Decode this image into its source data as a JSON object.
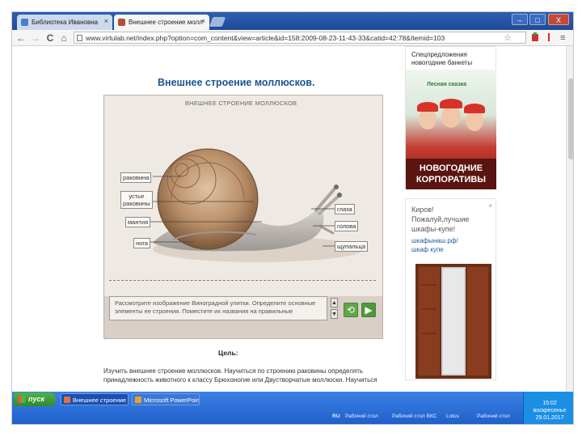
{
  "browser": {
    "tabs": [
      {
        "label": "Библиотека Ивановна",
        "close": "×"
      },
      {
        "label": "Внешнее строение молл",
        "close": "×"
      }
    ],
    "window_buttons": {
      "minimize": "–",
      "maximize": "□",
      "close": "X"
    },
    "nav": {
      "back": "←",
      "forward": "→",
      "reload": "C",
      "home": "⌂"
    },
    "url": "www.virtulab.net/index.php?option=com_content&view=article&id=158:2009-08-23-11-43-33&catid=42:78&Itemid=103",
    "star": "☆",
    "menu": "≡"
  },
  "page": {
    "title": "Внешнее строение моллюсков.",
    "widget": {
      "stage_title": "ВНЕШНЕЕ СТРОЕНИЕ МОЛЛЮСКОВ",
      "labels": {
        "shell": "раковина",
        "shell_mouth_1": "устье",
        "shell_mouth_2": "раковины",
        "mantle": "мантия",
        "foot": "нога",
        "eyes": "глаза",
        "head": "голова",
        "tentacles": "щупальца"
      },
      "instruction": "Рассмотрите изображение Виноградной улитки. Определите основные элементы ее строения. Поместите их названия на правильные",
      "spin_up": "▲",
      "spin_down": "▼",
      "reset_icon": "⟲",
      "next_icon": "▶"
    },
    "goal_heading": "Цель:",
    "goal_text": "Изучить внешнее строение моллюсков. Научиться по строению раковины определять принадлежность животного к классу Брюхоногие или Двустворчатые моллюски. Научиться"
  },
  "ads": {
    "ad1": {
      "text_line1": "Спецпредложения",
      "text_line2": "новогодние банкеты",
      "brand": "Лесная сказка",
      "banner_line1": "НОВОГОДНИЕ",
      "banner_line2": "КОРПОРАТИВЫ"
    },
    "ad2": {
      "close": "×",
      "line1": "Киров!",
      "line2": "Пожалуй,лучшие",
      "line3": "шкафы-купе!",
      "link1": "шкафынаш.рф/",
      "link2": "шкаф купе"
    }
  },
  "taskbar": {
    "start": "пуск",
    "items": [
      {
        "label": "Внешнее строение м..."
      },
      {
        "label": "Microsoft PowerPoint ..."
      }
    ],
    "tray_labels": [
      "RU",
      "Рабочий стол",
      "Рабочий стол ВКС",
      "Lotus",
      "Рабочий стол"
    ],
    "clock_time": "15:02",
    "clock_day": "воскресенье",
    "clock_date": "29.01.2017"
  },
  "colors": {
    "title_blue": "#1a5590",
    "taskbar_blue": "#2565d4",
    "start_green": "#3c9c38"
  }
}
